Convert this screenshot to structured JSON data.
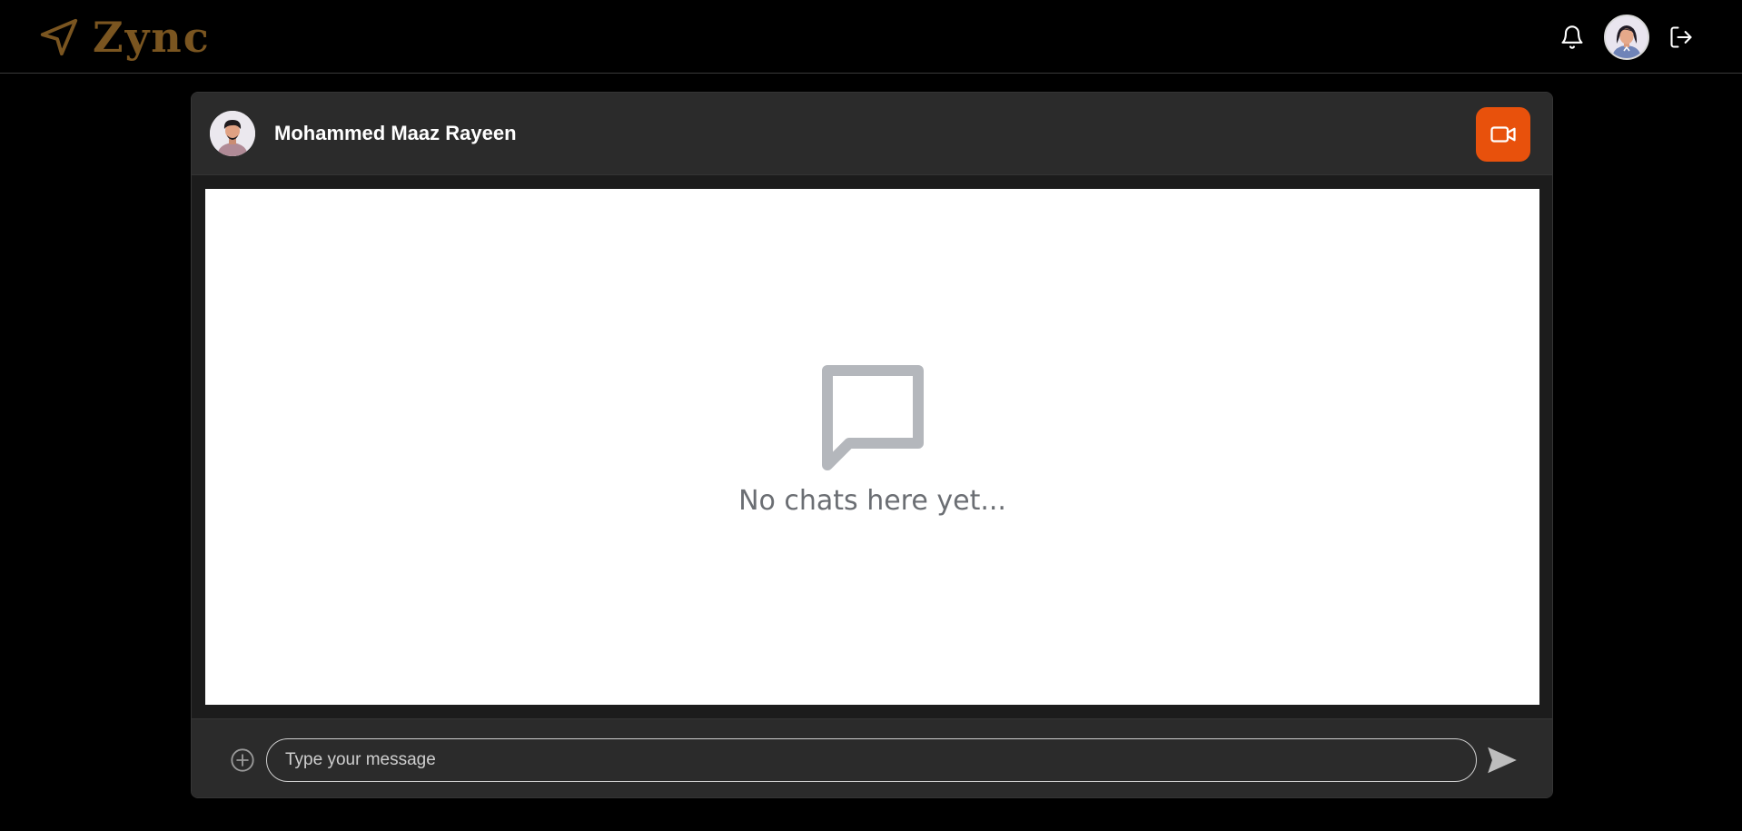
{
  "app": {
    "name": "Zync",
    "accent": "#e8510c",
    "brand_color": "#7a5520"
  },
  "topbar": {
    "icons": [
      "send-logo-icon",
      "bell-icon",
      "avatar",
      "logout-icon"
    ]
  },
  "chat": {
    "contact_name": "Mohammed Maaz Rayeen",
    "video_call_icon": "video-camera-icon",
    "empty_state": {
      "icon": "chat-bubble-icon",
      "text": "No chats here yet..."
    },
    "composer": {
      "attach_icon": "plus-circle-icon",
      "placeholder": "Type your message",
      "value": "",
      "send_icon": "send-icon"
    }
  }
}
